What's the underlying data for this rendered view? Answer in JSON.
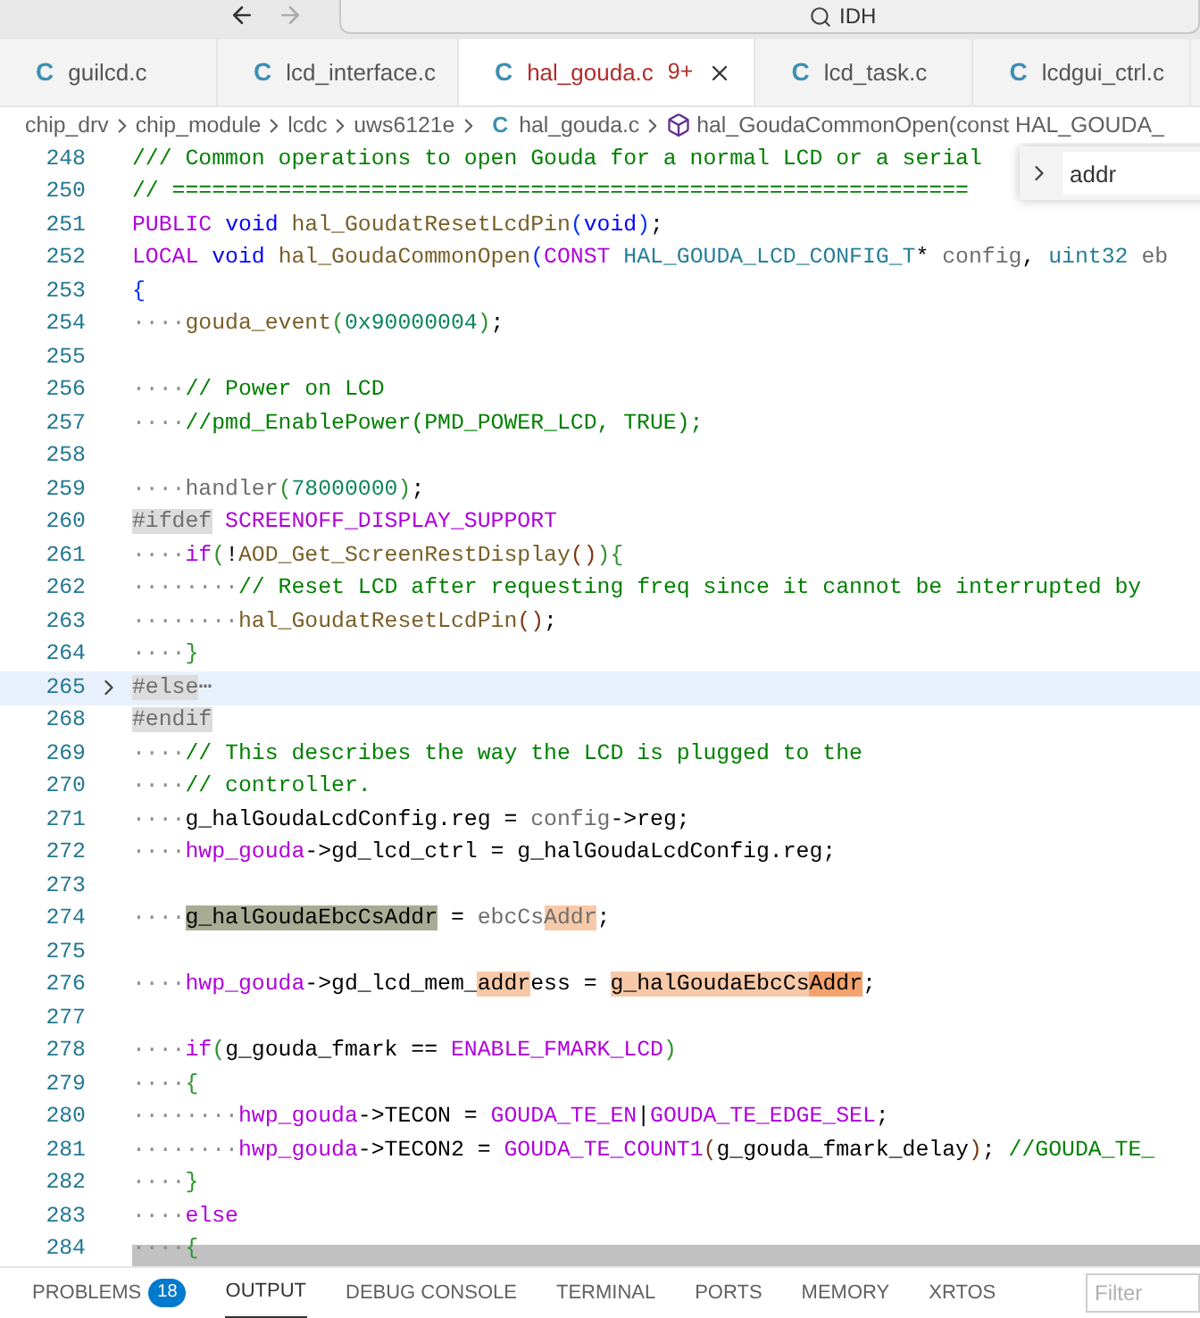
{
  "title_bar": {
    "search": "IDH"
  },
  "tabs": [
    {
      "icon": "C",
      "label": "guilcd.c",
      "selected": false
    },
    {
      "icon": "C",
      "label": "lcd_interface.c",
      "selected": false
    },
    {
      "icon": "C",
      "label": "hal_gouda.c",
      "badge": "9+",
      "selected": true
    },
    {
      "icon": "C",
      "label": "lcd_task.c",
      "selected": false
    },
    {
      "icon": "C",
      "label": "lcdgui_ctrl.c",
      "selected": false
    }
  ],
  "breadcrumbs": [
    {
      "label": "chip_drv"
    },
    {
      "label": "chip_module"
    },
    {
      "label": "lcdc"
    },
    {
      "label": "uws6121e"
    },
    {
      "icon": "C",
      "label": "hal_gouda.c"
    },
    {
      "kind": "symbol",
      "label": "hal_GoudaCommonOpen(const HAL_GOUDA_"
    }
  ],
  "find": {
    "value": "addr"
  },
  "lines": [
    {
      "number": "248",
      "tokens": [
        {
          "kind": "cm",
          "text": "/// Common operations to open Gouda for a normal LCD or a serial"
        }
      ]
    },
    {
      "number": "250",
      "tokens": [
        {
          "kind": "cm",
          "text": "// ============================================================"
        }
      ]
    },
    {
      "number": "251",
      "tokens": [
        {
          "kind": "macro",
          "text": "PUBLIC "
        },
        {
          "kind": "kw",
          "text": "void "
        },
        {
          "kind": "fn",
          "text": "hal_GoudatResetLcdPin"
        },
        {
          "kind": "br1",
          "text": "("
        },
        {
          "kind": "kw",
          "text": "void"
        },
        {
          "kind": "br1",
          "text": ")"
        },
        {
          "kind": "plain",
          "text": ";"
        }
      ]
    },
    {
      "number": "252",
      "tokens": [
        {
          "kind": "macro",
          "text": "LOCAL "
        },
        {
          "kind": "kw",
          "text": "void "
        },
        {
          "kind": "fn",
          "text": "hal_GoudaCommonOpen"
        },
        {
          "kind": "br1",
          "text": "("
        },
        {
          "kind": "macro",
          "text": "CONST "
        },
        {
          "kind": "type",
          "text": "HAL_GOUDA_LCD_CONFIG_T"
        },
        {
          "kind": "plain",
          "text": "* "
        },
        {
          "kind": "dim",
          "text": "config"
        },
        {
          "kind": "plain",
          "text": ", "
        },
        {
          "kind": "type",
          "text": "uint32 "
        },
        {
          "kind": "dim",
          "text": "eb"
        }
      ]
    },
    {
      "number": "253",
      "tokens": [
        {
          "kind": "br1",
          "text": "{"
        }
      ]
    },
    {
      "number": "254",
      "tokens": [
        {
          "kind": "ws",
          "text": "····"
        },
        {
          "kind": "fn",
          "text": "gouda_event"
        },
        {
          "kind": "br2",
          "text": "("
        },
        {
          "kind": "num",
          "text": "0x90000004"
        },
        {
          "kind": "br2",
          "text": ")"
        },
        {
          "kind": "plain",
          "text": ";"
        }
      ]
    },
    {
      "number": "255"
    },
    {
      "number": "256",
      "tokens": [
        {
          "kind": "ws",
          "text": "····"
        },
        {
          "kind": "cm",
          "text": "// Power on LCD"
        }
      ]
    },
    {
      "number": "257",
      "tokens": [
        {
          "kind": "ws",
          "text": "····"
        },
        {
          "kind": "cm",
          "text": "//pmd_EnablePower(PMD_POWER_LCD, TRUE);"
        }
      ]
    },
    {
      "number": "258"
    },
    {
      "number": "259",
      "tokens": [
        {
          "kind": "ws",
          "text": "····"
        },
        {
          "kind": "dim",
          "text": "handler"
        },
        {
          "kind": "br2",
          "text": "("
        },
        {
          "kind": "num",
          "text": "78000000"
        },
        {
          "kind": "br2",
          "text": ")"
        },
        {
          "kind": "plain",
          "text": ";"
        }
      ]
    },
    {
      "number": "260",
      "tokens": [
        {
          "kind": "pp",
          "text": "#ifdef"
        },
        {
          "kind": "macro",
          "text": " SCREENOFF_DISPLAY_SUPPORT"
        }
      ]
    },
    {
      "number": "261",
      "tokens": [
        {
          "kind": "ws",
          "text": "····"
        },
        {
          "kind": "macro",
          "text": "if"
        },
        {
          "kind": "br2",
          "text": "("
        },
        {
          "kind": "plain",
          "text": "!"
        },
        {
          "kind": "fn",
          "text": "AOD_Get_ScreenRestDisplay"
        },
        {
          "kind": "br3",
          "text": "()"
        },
        {
          "kind": "br2",
          "text": ")"
        },
        {
          "kind": "br2",
          "text": "{"
        }
      ]
    },
    {
      "number": "262",
      "tokens": [
        {
          "kind": "ws",
          "text": "········"
        },
        {
          "kind": "cm",
          "text": "// Reset LCD after requesting freq since it cannot be interrupted by"
        }
      ]
    },
    {
      "number": "263",
      "tokens": [
        {
          "kind": "ws",
          "text": "········"
        },
        {
          "kind": "fn",
          "text": "hal_GoudatResetLcdPin"
        },
        {
          "kind": "br3",
          "text": "()"
        },
        {
          "kind": "plain",
          "text": ";"
        }
      ]
    },
    {
      "number": "264",
      "tokens": [
        {
          "kind": "ws",
          "text": "····"
        },
        {
          "kind": "br2",
          "text": "}"
        }
      ]
    },
    {
      "number": "265",
      "folded": true,
      "tokens": [
        {
          "kind": "pp",
          "text": "#else"
        },
        {
          "kind": "dim",
          "text": "⋯"
        }
      ]
    },
    {
      "number": "268",
      "tokens": [
        {
          "kind": "pp",
          "text": "#endif"
        }
      ]
    },
    {
      "number": "269",
      "tokens": [
        {
          "kind": "ws",
          "text": "····"
        },
        {
          "kind": "cm",
          "text": "// This describes the way the LCD is plugged to the"
        }
      ]
    },
    {
      "number": "270",
      "tokens": [
        {
          "kind": "ws",
          "text": "····"
        },
        {
          "kind": "cm",
          "text": "// controller."
        }
      ]
    },
    {
      "number": "271",
      "tokens": [
        {
          "kind": "ws",
          "text": "····"
        },
        {
          "kind": "plain",
          "text": "g_halGoudaLcdConfig.reg = "
        },
        {
          "kind": "dim",
          "text": "config"
        },
        {
          "kind": "plain",
          "text": "->reg;"
        }
      ]
    },
    {
      "number": "272",
      "tokens": [
        {
          "kind": "ws",
          "text": "····"
        },
        {
          "kind": "macro",
          "text": "hwp_gouda"
        },
        {
          "kind": "plain",
          "text": "->gd_lcd_ctrl = g_halGoudaLcdConfig.reg;"
        }
      ]
    },
    {
      "number": "273"
    },
    {
      "number": "274",
      "tokens": [
        {
          "kind": "ws",
          "text": "····"
        },
        {
          "kind": "plain",
          "text": "g_halGoudaEbcCsAddr",
          "occurrence": true
        },
        {
          "kind": "plain",
          "text": " = "
        },
        {
          "kind": "dim",
          "text": "ebcCs"
        },
        {
          "kind": "dim",
          "text": "Addr",
          "match": true
        },
        {
          "kind": "plain",
          "text": ";"
        }
      ]
    },
    {
      "number": "275"
    },
    {
      "number": "276",
      "tokens": [
        {
          "kind": "ws",
          "text": "····"
        },
        {
          "kind": "macro",
          "text": "hwp_gouda"
        },
        {
          "kind": "plain",
          "text": "->gd_lcd_mem_"
        },
        {
          "kind": "plain",
          "text": "addr",
          "match": true
        },
        {
          "kind": "plain",
          "text": "ess = "
        },
        {
          "kind": "plain",
          "text": "g_halGoudaEbcCs",
          "match": true
        },
        {
          "kind": "plain",
          "text": "Addr",
          "current": true
        },
        {
          "kind": "plain",
          "text": ";"
        }
      ]
    },
    {
      "number": "277"
    },
    {
      "number": "278",
      "tokens": [
        {
          "kind": "ws",
          "text": "····"
        },
        {
          "kind": "macro",
          "text": "if"
        },
        {
          "kind": "br2",
          "text": "("
        },
        {
          "kind": "plain",
          "text": "g_gouda_fmark == "
        },
        {
          "kind": "macro",
          "text": "ENABLE_FMARK_LCD"
        },
        {
          "kind": "br2",
          "text": ")"
        }
      ]
    },
    {
      "number": "279",
      "tokens": [
        {
          "kind": "ws",
          "text": "····"
        },
        {
          "kind": "br2",
          "text": "{"
        }
      ]
    },
    {
      "number": "280",
      "tokens": [
        {
          "kind": "ws",
          "text": "········"
        },
        {
          "kind": "macro",
          "text": "hwp_gouda"
        },
        {
          "kind": "plain",
          "text": "->TECON = "
        },
        {
          "kind": "macro",
          "text": "GOUDA_TE_EN"
        },
        {
          "kind": "plain",
          "text": "|"
        },
        {
          "kind": "macro",
          "text": "GOUDA_TE_EDGE_SEL"
        },
        {
          "kind": "plain",
          "text": ";"
        }
      ]
    },
    {
      "number": "281",
      "tokens": [
        {
          "kind": "ws",
          "text": "········"
        },
        {
          "kind": "macro",
          "text": "hwp_gouda"
        },
        {
          "kind": "plain",
          "text": "->TECON2 = "
        },
        {
          "kind": "macro",
          "text": "GOUDA_TE_COUNT1"
        },
        {
          "kind": "br3",
          "text": "("
        },
        {
          "kind": "plain",
          "text": "g_gouda_fmark_delay"
        },
        {
          "kind": "br3",
          "text": ")"
        },
        {
          "kind": "plain",
          "text": "; "
        },
        {
          "kind": "cm",
          "text": "//GOUDA_TE_"
        }
      ]
    },
    {
      "number": "282",
      "tokens": [
        {
          "kind": "ws",
          "text": "····"
        },
        {
          "kind": "br2",
          "text": "}"
        }
      ]
    },
    {
      "number": "283",
      "tokens": [
        {
          "kind": "ws",
          "text": "····"
        },
        {
          "kind": "macro",
          "text": "else"
        }
      ]
    },
    {
      "number": "284",
      "tokens": [
        {
          "kind": "ws",
          "text": "····"
        },
        {
          "kind": "br2",
          "text": "{"
        }
      ]
    }
  ],
  "panel_tabs": [
    {
      "label": "PROBLEMS",
      "badge": "18",
      "selected": false
    },
    {
      "label": "OUTPUT",
      "selected": true
    },
    {
      "label": "DEBUG CONSOLE",
      "selected": false
    },
    {
      "label": "TERMINAL",
      "selected": false
    },
    {
      "label": "PORTS",
      "selected": false
    },
    {
      "label": "MEMORY",
      "selected": false
    },
    {
      "label": "XRTOS",
      "selected": false
    }
  ],
  "panel_filter": {
    "placeholder": "Filter"
  }
}
